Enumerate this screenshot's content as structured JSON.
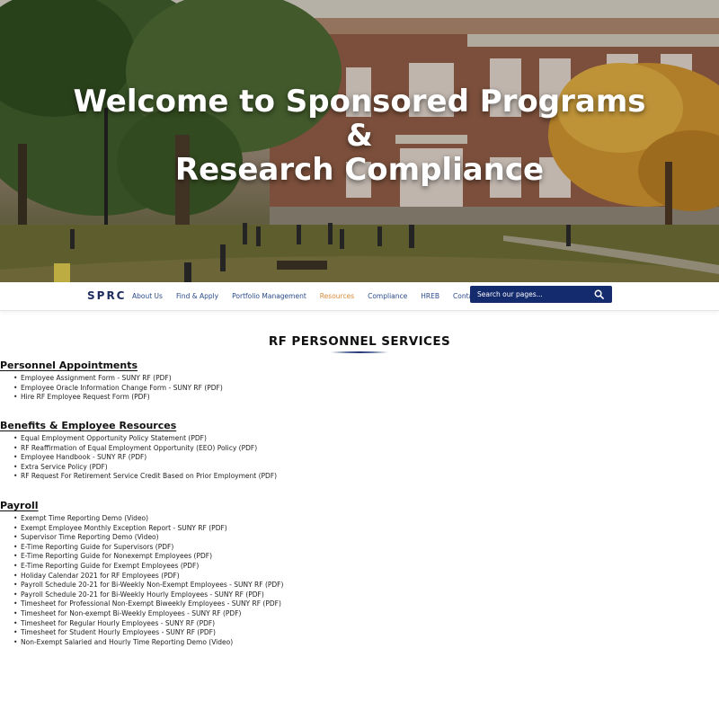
{
  "hero": {
    "title_line1": "Welcome to Sponsored Programs",
    "title_line2": "&",
    "title_line3": "Research Compliance"
  },
  "nav": {
    "brand": "SPRC",
    "items": [
      {
        "label": "About Us",
        "active": false
      },
      {
        "label": "Find & Apply",
        "active": false
      },
      {
        "label": "Portfolio Management",
        "active": false
      },
      {
        "label": "Resources",
        "active": true
      },
      {
        "label": "Compliance",
        "active": false
      },
      {
        "label": "HREB",
        "active": false
      },
      {
        "label": "Contact",
        "active": false
      }
    ],
    "search": {
      "placeholder": "Search our pages...",
      "value": "",
      "icon": "search-icon"
    }
  },
  "colors": {
    "brand": "#1d2c5e",
    "nav_link": "#2a4a8a",
    "nav_active": "#d98a3a",
    "search_bg": "#142b6e"
  },
  "main": {
    "page_title": "RF PERSONNEL SERVICES",
    "sections": [
      {
        "heading": "Personnel Appointments",
        "items": [
          "Employee Assignment Form - SUNY RF (PDF)",
          "Employee Oracle Information Change Form - SUNY RF (PDF)",
          "Hire RF Employee Request Form (PDF)"
        ]
      },
      {
        "heading": "Benefits & Employee Resources",
        "items": [
          "Equal Employment Opportunity Policy Statement (PDF)",
          "RF Reaffirmation of Equal Employment Opportunity (EEO) Policy (PDF)",
          "Employee Handbook - SUNY RF (PDF)",
          "Extra Service Policy (PDF)",
          "RF Request For Retirement Service Credit Based on Prior Employment (PDF)"
        ]
      },
      {
        "heading": "Payroll",
        "items": [
          "Exempt Time Reporting Demo (Video)",
          "Exempt Employee Monthly Exception Report - SUNY RF (PDF)",
          "Supervisor Time Reporting Demo (Video)",
          "E-Time Reporting Guide for Supervisors (PDF)",
          "E-Time Reporting Guide for Nonexempt Employees (PDF)",
          "E-Time Reporting Guide for Exempt Employees (PDF)",
          "Holiday Calendar 2021 for RF Employees (PDF)",
          "Payroll Schedule 20-21 for Bi-Weekly Non-Exempt Employees - SUNY RF (PDF)",
          "Payroll Schedule 20-21 for Bi-Weekly Hourly Employees - SUNY RF (PDF)",
          "Timesheet for Professional Non-Exempt Biweekly Employees - SUNY RF (PDF)",
          "Timesheet for Non-exempt Bi-Weekly Employees - SUNY RF (PDF)",
          "Timesheet for Regular Hourly Employees - SUNY RF (PDF)",
          "Timesheet for Student Hourly Employees - SUNY RF (PDF)",
          "Non-Exempt Salaried and Hourly Time Reporting Demo (Video)"
        ]
      }
    ]
  }
}
